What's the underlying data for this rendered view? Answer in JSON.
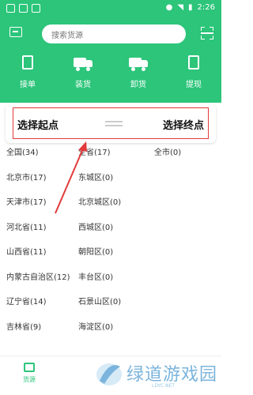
{
  "status_bar": {
    "time": "2:26"
  },
  "header": {
    "search_placeholder": "搜索货源",
    "actions": [
      {
        "label": "接单",
        "icon": "document-icon"
      },
      {
        "label": "装货",
        "icon": "truck-icon"
      },
      {
        "label": "卸货",
        "icon": "truck-icon"
      },
      {
        "label": "提现",
        "icon": "document-icon"
      }
    ]
  },
  "route": {
    "start_label": "选择起点",
    "end_label": "选择终点"
  },
  "regions": {
    "provinces": [
      "全国(34)",
      "北京市(17)",
      "天津市(17)",
      "河北省(11)",
      "山西省(11)",
      "内蒙古自治区(12)",
      "辽宁省(14)",
      "吉林省(9)"
    ],
    "districts": [
      "全省(17)",
      "东城区(0)",
      "北京城区(0)",
      "西城区(0)",
      "朝阳区(0)",
      "丰台区(0)",
      "石景山区(0)",
      "海淀区(0)"
    ],
    "cities": [
      "全市(0)"
    ]
  },
  "tabbar": {
    "tab_label": "货源"
  },
  "watermark": {
    "text": "绿道游戏园",
    "sub": "LDYC.NET"
  },
  "colors": {
    "brand_green": "#2cc57a",
    "highlight_red": "#e23a3a"
  }
}
